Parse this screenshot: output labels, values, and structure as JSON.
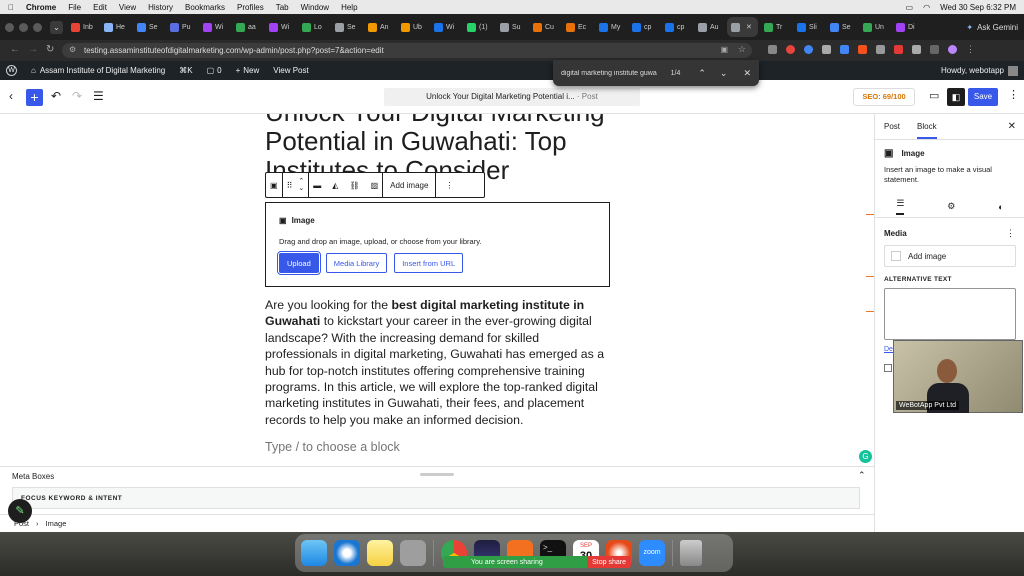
{
  "macbar": {
    "menus": [
      "Chrome",
      "File",
      "Edit",
      "View",
      "History",
      "Bookmarks",
      "Profiles",
      "Tab",
      "Window",
      "Help"
    ],
    "datetime": "Wed 30 Sep  6:32 PM",
    "ask": "Ask Gemini"
  },
  "tabs": [
    {
      "label": "Inb",
      "color": "#ea4335"
    },
    {
      "label": "He",
      "color": "#8ab4f8"
    },
    {
      "label": "Se",
      "color": "#4285f4"
    },
    {
      "label": "Pu",
      "color": "#5b6ee1"
    },
    {
      "label": "Wi",
      "color": "#a142f4"
    },
    {
      "label": "aa",
      "color": "#34a853"
    },
    {
      "label": "Wi",
      "color": "#a142f4"
    },
    {
      "label": "Lo",
      "color": "#34a853"
    },
    {
      "label": "Se",
      "color": "#9aa0a6"
    },
    {
      "label": "An",
      "color": "#f29900"
    },
    {
      "label": "Ub",
      "color": "#f29900"
    },
    {
      "label": "Wi",
      "color": "#1a73e8"
    },
    {
      "label": "(1)",
      "color": "#25d366"
    },
    {
      "label": "Su",
      "color": "#9aa0a6"
    },
    {
      "label": "Cu",
      "color": "#e8710a"
    },
    {
      "label": "Ec",
      "color": "#e8710a"
    },
    {
      "label": "My",
      "color": "#1a73e8"
    },
    {
      "label": "cp",
      "color": "#1a73e8"
    },
    {
      "label": "cp",
      "color": "#1a73e8"
    },
    {
      "label": "Au",
      "color": "#9aa0a6"
    },
    {
      "label": "",
      "color": "#9aa0a6",
      "active": true
    },
    {
      "label": "Tr",
      "color": "#34a853"
    },
    {
      "label": "Sli",
      "color": "#1a73e8"
    },
    {
      "label": "Se",
      "color": "#4285f4"
    },
    {
      "label": "Un",
      "color": "#34a853"
    },
    {
      "label": "Di",
      "color": "#a142f4"
    }
  ],
  "url": "testing.assaminstituteofdigitalmarketing.com/wp-admin/post.php?post=7&action=edit",
  "wpbar": {
    "site": "Assam Institute of Digital Marketing",
    "shortcut": "⌘K",
    "comments": "0",
    "new": "New",
    "view": "View Post",
    "howdy": "Howdy, webotapp"
  },
  "find": {
    "query": "digital marketing institute guwa",
    "count": "1/4"
  },
  "editor": {
    "doc_title": "Unlock Your Digital Marketing Potential i...",
    "doc_type": "· Post",
    "seo": "SEO: 69/100",
    "save": "Save"
  },
  "post": {
    "title": "Unlock Your Digital Marketing Potential in Guwahati: Top Institutes to Consider",
    "toolbar_add": "Add image",
    "image_block": {
      "label": "Image",
      "instructions": "Drag and drop an image, upload, or choose from your library.",
      "upload": "Upload",
      "media_library": "Media Library",
      "insert_url": "Insert from URL"
    },
    "para_a": "Are you looking for the ",
    "para_bold": "best digital marketing institute in Guwahati",
    "para_b": " to kickstart your career in the ever-growing digital landscape? With the increasing demand for skilled professionals in digital marketing, Guwahati has emerged as a hub for top-notch institutes offering comprehensive training programs. In this article, we will explore the top-ranked digital marketing institutes in Guwahati, their fees, and placement records to help you make an informed decision.",
    "type_hint": "Type / to choose a block"
  },
  "meta": {
    "title": "Meta Boxes",
    "focus": "FOCUS KEYWORD & INTENT"
  },
  "breadcrumb": {
    "root": "Post",
    "current": "Image"
  },
  "sidebar": {
    "tab_post": "Post",
    "tab_block": "Block",
    "block_name": "Image",
    "block_desc": "Insert an image to make a visual statement.",
    "media": "Media",
    "add_image": "Add image",
    "alt_label": "ALTERNATIVE TEXT",
    "desc_link": "Des"
  },
  "webcam": {
    "label": "WeBotApp Pvt Ltd"
  },
  "share": {
    "text": "You are screen sharing",
    "stop": "Stop share"
  },
  "dock": {
    "calendar_month": "SEP",
    "calendar_day": "30",
    "zoom": "zoom"
  }
}
